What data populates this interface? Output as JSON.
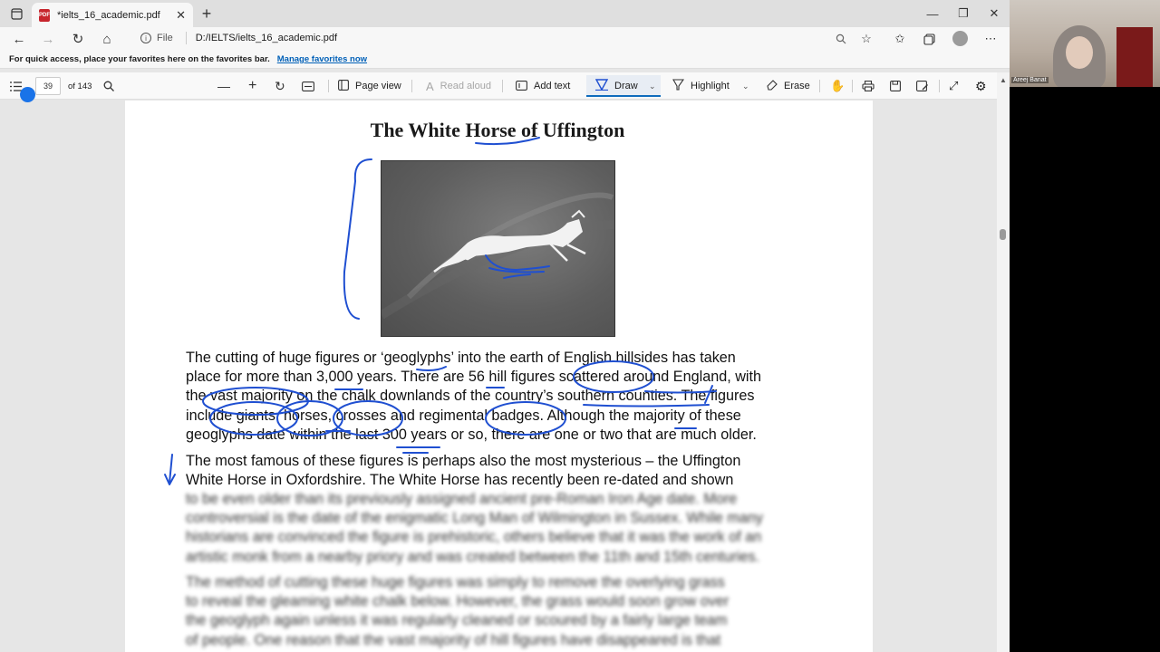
{
  "browser": {
    "tab_title": "*ielts_16_academic.pdf",
    "tab_close": "✕",
    "new_tab": "+",
    "window_controls": [
      "—",
      "❐",
      "✕"
    ]
  },
  "navbar": {
    "back": "←",
    "forward": "→",
    "reload": "↻",
    "home": "⌂",
    "file_label": "File",
    "url": "D:/IELTS/ielts_16_academic.pdf"
  },
  "favbar": {
    "text": "For quick access, place your favorites here on the favorites bar.",
    "link": "Manage favorites now"
  },
  "pdf_toolbar": {
    "page_number": "39",
    "page_total": "of 143",
    "page_view": "Page view",
    "read_aloud": "Read aloud",
    "add_text": "Add text",
    "draw": "Draw",
    "highlight": "Highlight",
    "erase": "Erase"
  },
  "document": {
    "title": "The White Horse of Uffington",
    "para1": [
      "The cutting of huge figures or ‘geoglyphs’ into the earth of English hillsides has taken",
      "place for more than 3,000 years. There are 56 hill figures scattered around England, with",
      "the vast majority on the chalk downlands of the country’s southern counties. The figures",
      "include giants, horses, crosses and regimental badges. Although the majority of these",
      "geoglyphs date within the last 300 years or so, there are one or two that are much older."
    ],
    "para2": [
      "The most famous of these figures is perhaps also the most mysterious – the Uffington",
      "White Horse in Oxfordshire. The White Horse has recently been re-dated and shown"
    ],
    "para2_blurred": [
      "to be even older than its previously assigned ancient pre-Roman Iron Age date. More",
      "controversial is the date of the enigmatic Long Man of Wilmington in Sussex. While many",
      "historians are convinced the figure is prehistoric, others believe that it was the work of an",
      "artistic monk from a nearby priory and was created between the 11th and 15th centuries."
    ],
    "para3_blurred": [
      "The method of cutting these huge figures was simply to remove the overlying grass",
      "to reveal the gleaming white chalk below. However, the grass would soon grow over",
      "the geoglyph again unless it was regularly cleaned or scoured by a fairly large team",
      "of people. One reason that the vast majority of hill figures have disappeared is that"
    ]
  },
  "webcam": {
    "name": "Areej Banat"
  },
  "colors": {
    "annotation_ink": "#1f4fd1",
    "accent": "#0f6cbd"
  }
}
